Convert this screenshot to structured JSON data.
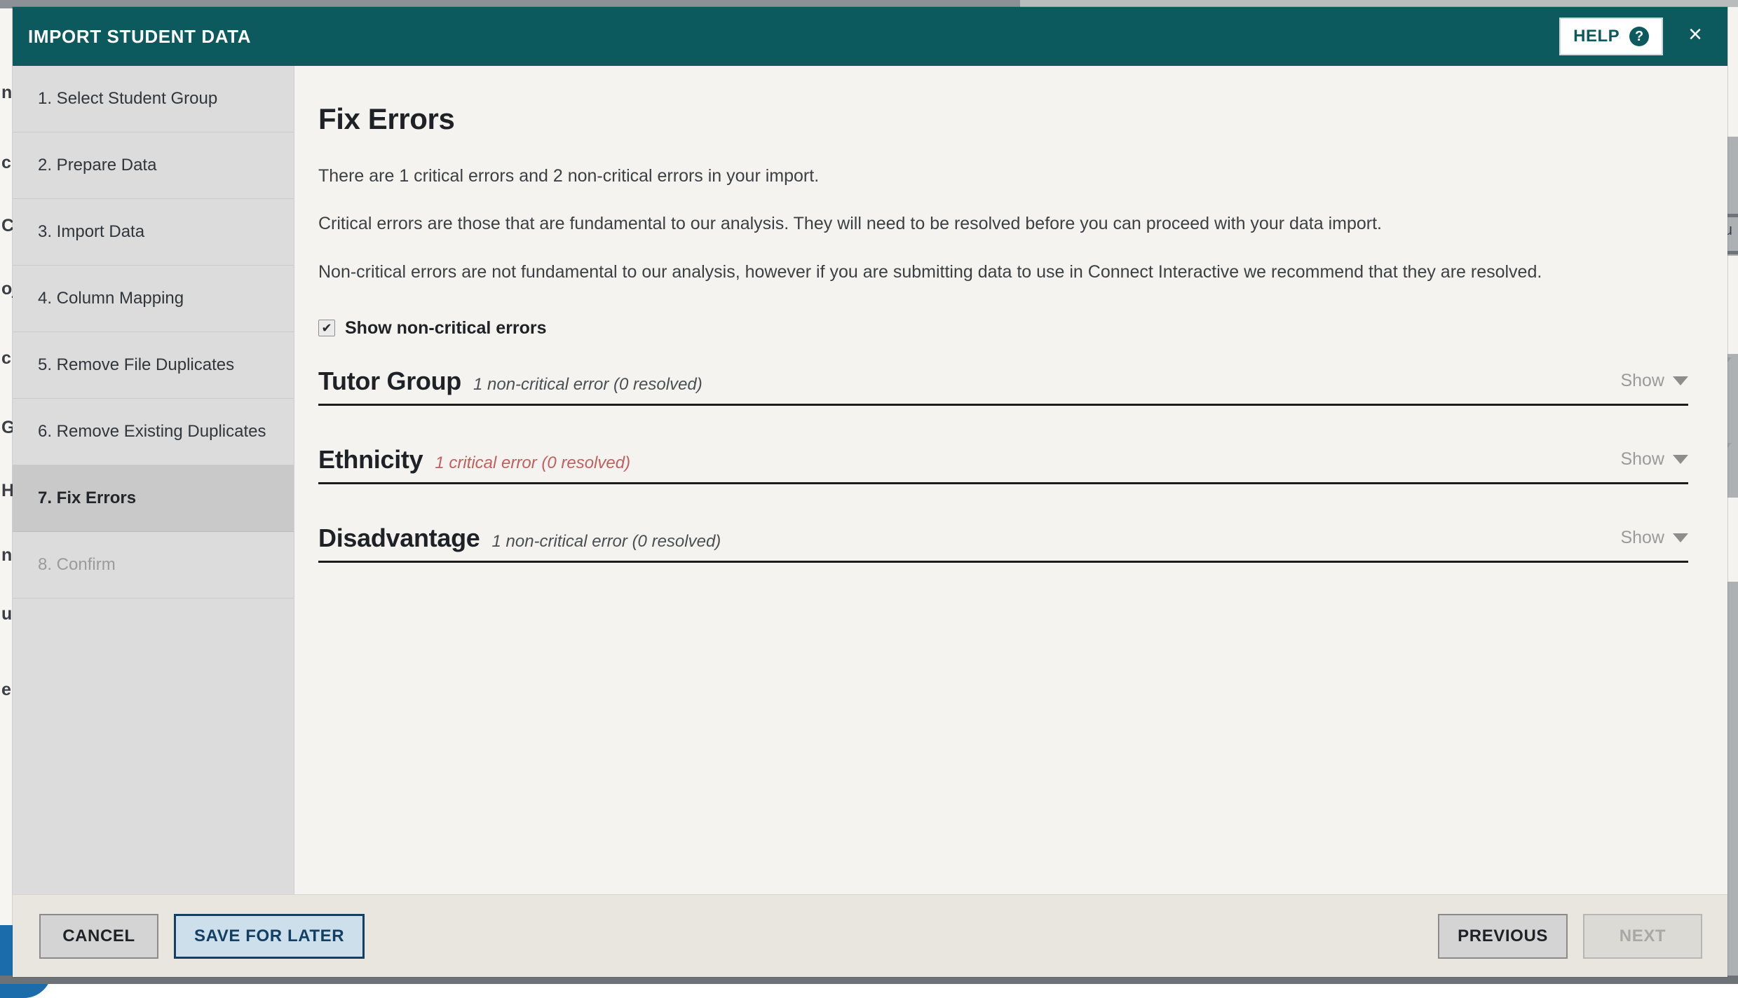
{
  "header": {
    "title": "IMPORT STUDENT DATA",
    "help_label": "HELP",
    "help_icon": "question-mark-circle-icon",
    "close_icon": "×"
  },
  "sidebar": {
    "items": [
      {
        "label": "1. Select Student Group",
        "state": ""
      },
      {
        "label": "2. Prepare Data",
        "state": ""
      },
      {
        "label": "3. Import Data",
        "state": ""
      },
      {
        "label": "4. Column Mapping",
        "state": ""
      },
      {
        "label": "5. Remove File Duplicates",
        "state": ""
      },
      {
        "label": "6. Remove Existing Duplicates",
        "state": ""
      },
      {
        "label": "7. Fix Errors",
        "state": "active"
      },
      {
        "label": "8. Confirm",
        "state": "disabled"
      }
    ]
  },
  "main": {
    "title": "Fix Errors",
    "paragraphs": [
      "There are 1 critical errors and 2 non-critical errors in your import.",
      "Critical errors are those that are fundamental to our analysis. They will need to be resolved before you can proceed with your data import.",
      "Non-critical errors are not fundamental to our analysis, however if you are submitting data to use in Connect Interactive we recommend that they are resolved."
    ],
    "show_noncritical": {
      "label": "Show non-critical errors",
      "checked": true,
      "check_glyph": "✔"
    },
    "sections": [
      {
        "name": "Tutor Group",
        "meta": "1 non-critical error (0 resolved)",
        "severity": "non-critical",
        "toggle_label": "Show"
      },
      {
        "name": "Ethnicity",
        "meta": "1 critical error (0 resolved)",
        "severity": "critical",
        "toggle_label": "Show"
      },
      {
        "name": "Disadvantage",
        "meta": "1 non-critical error (0 resolved)",
        "severity": "non-critical",
        "toggle_label": "Show"
      }
    ]
  },
  "footer": {
    "cancel_label": "CANCEL",
    "save_label": "SAVE FOR LATER",
    "previous_label": "PREVIOUS",
    "next_label": "NEXT"
  },
  "colors": {
    "header_teal": "#0d5a5e",
    "sidebar_gray": "#dcdcdc",
    "active_step_gray": "#c9c9c9",
    "content_bg": "#f4f3ef",
    "footer_bg": "#e8e6df",
    "critical_red": "#c0605f",
    "primary_blue": "#123f63",
    "primary_blue_fill": "#cddfeb",
    "chat_blue": "#1b6cab"
  },
  "backdrop": {
    "left_ghost_text": [
      "n",
      "c",
      "C",
      "oj",
      "c",
      "G",
      "H",
      "n",
      "u",
      "e"
    ],
    "right_ghost_text": [
      "cu"
    ]
  }
}
